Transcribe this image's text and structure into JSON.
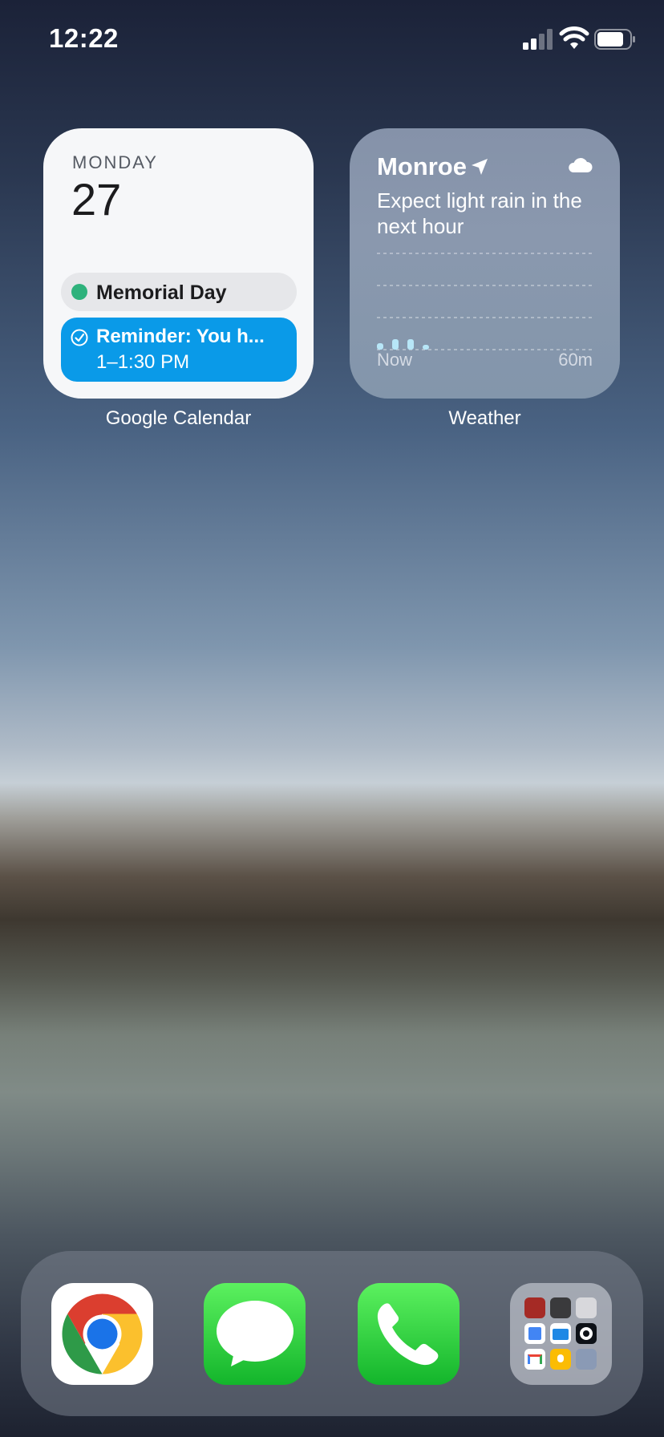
{
  "status_bar": {
    "time": "12:22",
    "signal_icon": "cellular-signal-icon",
    "wifi_icon": "wifi-icon",
    "battery_icon": "battery-icon"
  },
  "calendar_widget": {
    "app_label": "Google Calendar",
    "weekday": "MONDAY",
    "date": "27",
    "holiday": {
      "label": "Memorial Day",
      "color": "#2eb27c"
    },
    "event": {
      "title": "Reminder: You h...",
      "time": "1–1:30 PM",
      "color": "#0a9ae8"
    }
  },
  "weather_widget": {
    "app_label": "Weather",
    "city": "Monroe",
    "description": "Expect light rain in the next hour",
    "axis_start": "Now",
    "axis_end": "60m"
  },
  "dock": {
    "apps": [
      {
        "name": "Chrome",
        "icon": "chrome-icon"
      },
      {
        "name": "Messages",
        "icon": "messages-icon"
      },
      {
        "name": "Phone",
        "icon": "phone-icon"
      },
      {
        "name": "Folder",
        "icon": "app-folder-icon"
      }
    ]
  }
}
